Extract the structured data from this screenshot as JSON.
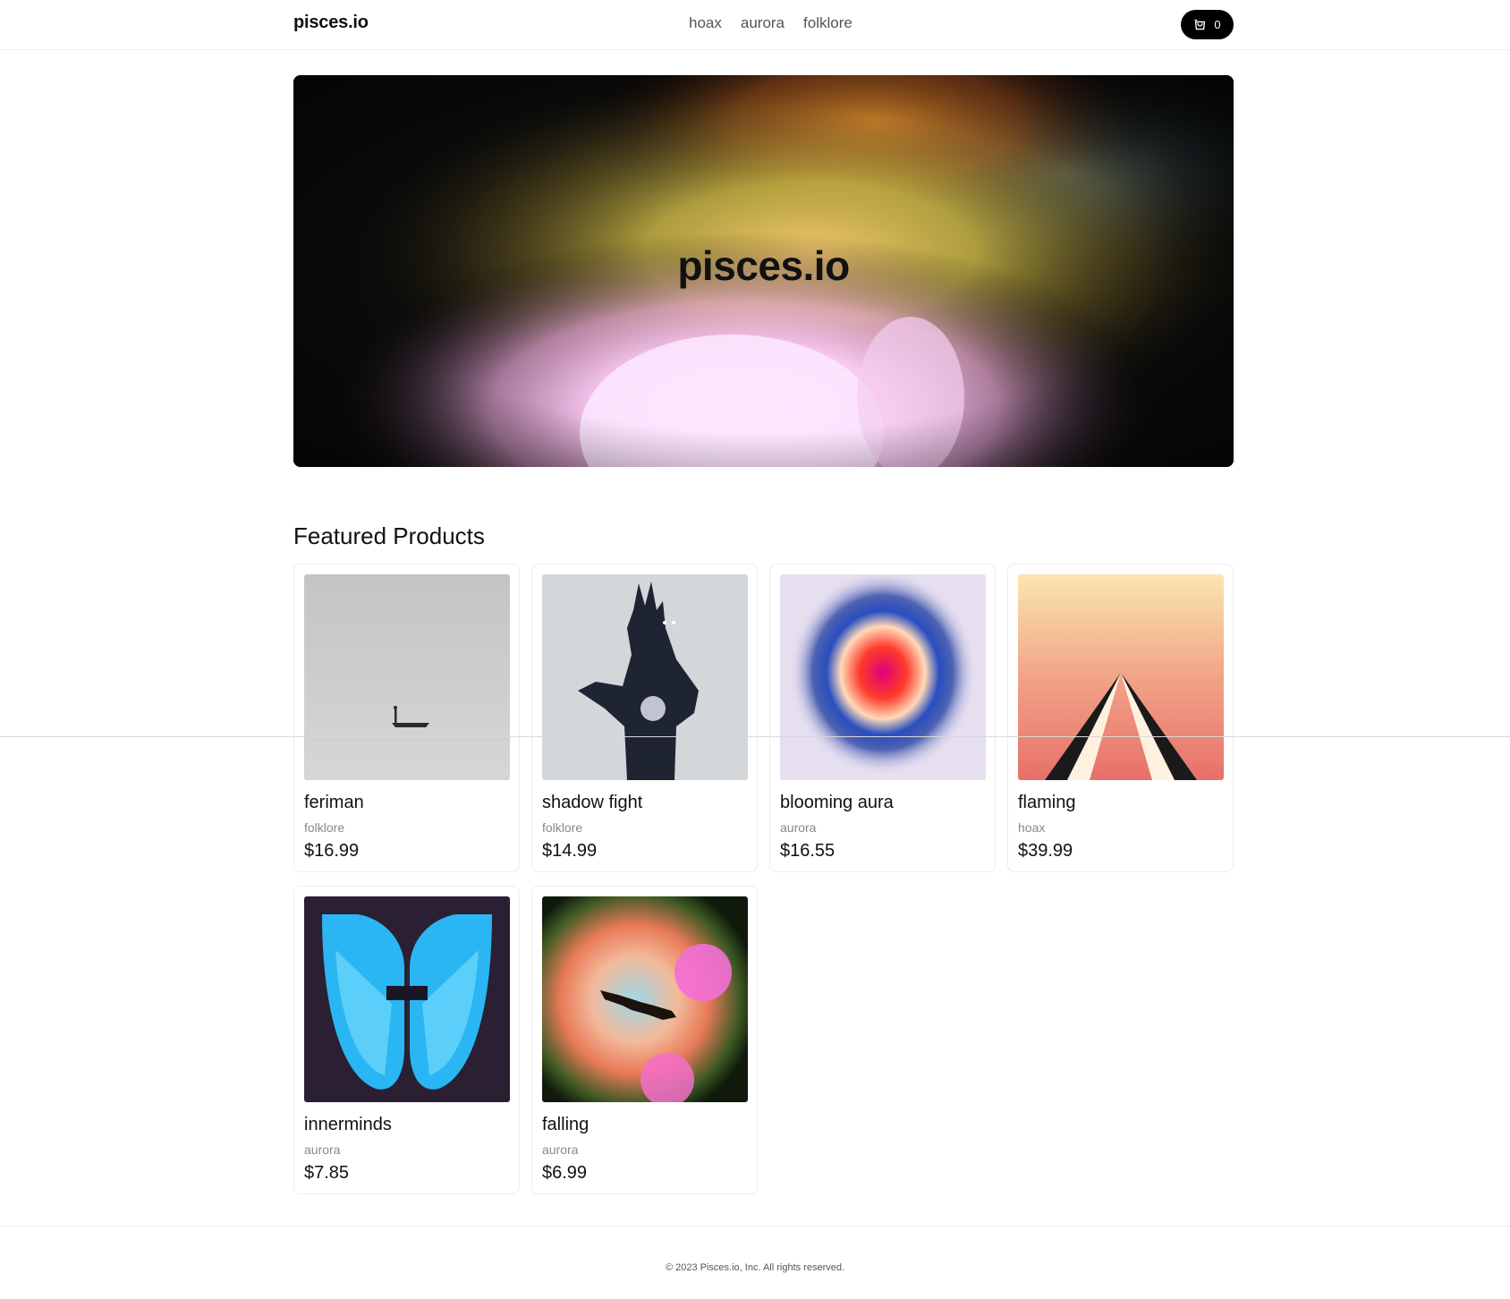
{
  "header": {
    "logo": "pisces.io",
    "nav": [
      {
        "label": "hoax"
      },
      {
        "label": "aurora"
      },
      {
        "label": "folklore"
      }
    ],
    "cart_count": "0",
    "cart_icon": "shopping-bag-icon"
  },
  "hero": {
    "title": "pisces.io"
  },
  "featured": {
    "title": "Featured Products",
    "products": [
      {
        "name": "feriman",
        "category": "folklore",
        "price": "$16.99"
      },
      {
        "name": "shadow fight",
        "category": "folklore",
        "price": "$14.99"
      },
      {
        "name": "blooming aura",
        "category": "aurora",
        "price": "$16.55"
      },
      {
        "name": "flaming",
        "category": "hoax",
        "price": "$39.99"
      },
      {
        "name": "innerminds",
        "category": "aurora",
        "price": "$7.85"
      },
      {
        "name": "falling",
        "category": "aurora",
        "price": "$6.99"
      }
    ]
  },
  "footer": {
    "copyright": "© 2023 Pisces.io, Inc. All rights reserved."
  },
  "colors": {
    "accent": "#000000",
    "text": "#111111",
    "muted": "#888888"
  }
}
